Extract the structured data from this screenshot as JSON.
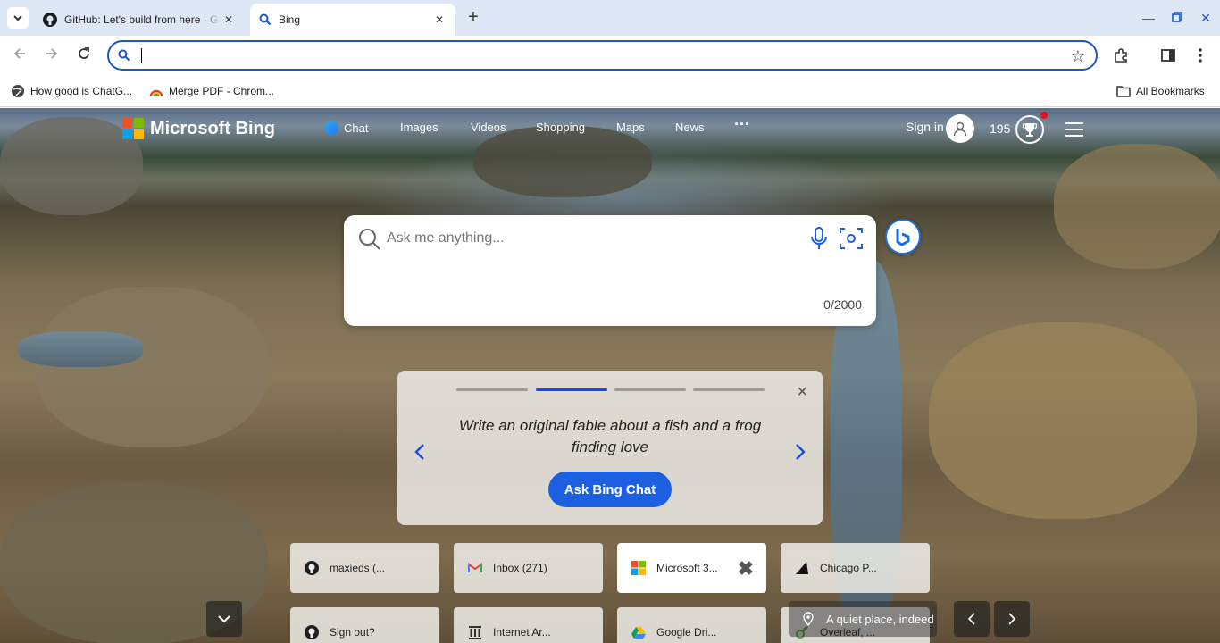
{
  "browser": {
    "tabs": [
      {
        "title": "GitHub: Let's build from here · G",
        "icon": "github-icon",
        "active": false
      },
      {
        "title": "Bing",
        "icon": "search-icon",
        "active": true
      }
    ],
    "omnibox": {
      "value": "",
      "placeholder": ""
    },
    "bookmarks": [
      {
        "label": "How good is ChatG...",
        "icon": "globe-icon"
      },
      {
        "label": "Merge PDF - Chrom...",
        "icon": "merge-pdf-icon"
      }
    ],
    "all_bookmarks_label": "All Bookmarks"
  },
  "bing": {
    "logo_text": "Microsoft Bing",
    "nav": [
      "Chat",
      "Images",
      "Videos",
      "Shopping",
      "Maps",
      "News",
      "···"
    ],
    "sign_in": "Sign in",
    "points": "195",
    "search": {
      "placeholder": "Ask me anything...",
      "char_count": "0/2000"
    },
    "suggestion": {
      "prompt": "Write an original fable about a fish and a frog finding love",
      "button": "Ask Bing Chat",
      "active_step": 2,
      "total_steps": 4
    },
    "quick_links": [
      {
        "label": "maxieds (...",
        "icon": "github-icon"
      },
      {
        "label": "Inbox (271)",
        "icon": "gmail-icon"
      },
      {
        "label": "Microsoft 3...",
        "icon": "microsoft-icon"
      },
      {
        "label": "Chicago P...",
        "icon": "chicago-icon"
      },
      {
        "label": "Sign out?",
        "icon": "github-icon"
      },
      {
        "label": "Internet Ar...",
        "icon": "archive-icon"
      },
      {
        "label": "Google Dri...",
        "icon": "google-drive-icon"
      },
      {
        "label": "Overleaf, ...",
        "icon": "overleaf-icon"
      }
    ],
    "location_caption": "A quiet place, indeed"
  },
  "colors": {
    "accent_blue": "#1c5fe0",
    "tabstrip_bg": "#dee7f6"
  }
}
